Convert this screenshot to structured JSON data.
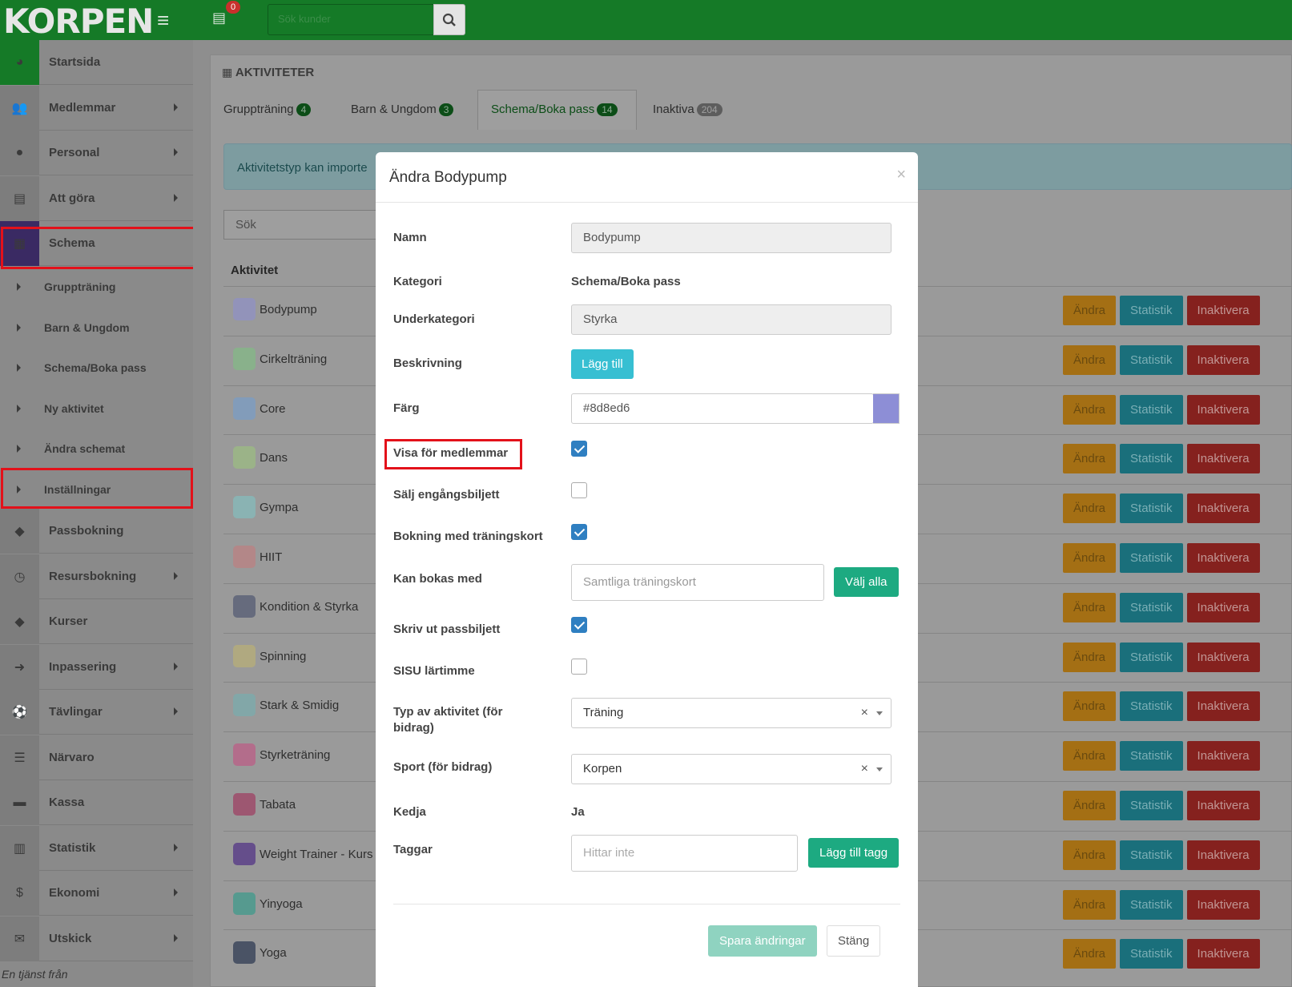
{
  "topbar": {
    "logo": "KORPEN",
    "notif_count": "0",
    "search_placeholder": "Sök kunder"
  },
  "sidebar": {
    "items": [
      {
        "label": "Startsida",
        "icon": "dashboard-icon",
        "arrow": false
      },
      {
        "label": "Medlemmar",
        "icon": "users-icon",
        "arrow": true
      },
      {
        "label": "Personal",
        "icon": "user-icon",
        "arrow": true
      },
      {
        "label": "Att göra",
        "icon": "list-icon",
        "arrow": true
      },
      {
        "label": "Schema",
        "icon": "calendar-icon",
        "arrow": false
      }
    ],
    "sub_items": [
      "Gruppträning",
      "Barn & Ungdom",
      "Schema/Boka pass",
      "Ny aktivitet",
      "Ändra schemat",
      "Inställningar"
    ],
    "items_after": [
      {
        "label": "Passbokning",
        "icon": "ticket-icon",
        "arrow": false
      },
      {
        "label": "Resursbokning",
        "icon": "clock-icon",
        "arrow": true
      },
      {
        "label": "Kurser",
        "icon": "ticket-icon",
        "arrow": false
      },
      {
        "label": "Inpassering",
        "icon": "sign-in-icon",
        "arrow": true
      },
      {
        "label": "Tävlingar",
        "icon": "soccer-icon",
        "arrow": true
      },
      {
        "label": "Närvaro",
        "icon": "list-lines-icon",
        "arrow": false
      },
      {
        "label": "Kassa",
        "icon": "register-icon",
        "arrow": false
      },
      {
        "label": "Statistik",
        "icon": "bar-chart-icon",
        "arrow": true
      },
      {
        "label": "Ekonomi",
        "icon": "dollar-icon",
        "arrow": true
      },
      {
        "label": "Utskick",
        "icon": "envelope-icon",
        "arrow": true
      }
    ],
    "footer": "En tjänst från"
  },
  "main": {
    "title": "AKTIVITETER",
    "tabs": [
      {
        "label": "Gruppträning",
        "count": "4"
      },
      {
        "label": "Barn & Ungdom",
        "count": "3"
      },
      {
        "label": "Schema/Boka pass",
        "count": "14"
      },
      {
        "label": "Inaktiva",
        "count": "204"
      }
    ],
    "alert": "Aktivitetstyp kan importe",
    "search_placeholder": "Sök",
    "column_header": "Aktivitet",
    "buttons": {
      "edit": "Ändra",
      "stats": "Statistik",
      "deactivate": "Inaktivera"
    },
    "rows": [
      {
        "name": "Bodypump",
        "color": "#8d8ed6"
      },
      {
        "name": "Cirkelträning",
        "color": "#7bc47f"
      },
      {
        "name": "Core",
        "color": "#6f9fd6"
      },
      {
        "name": "Dans",
        "color": "#9cc87a"
      },
      {
        "name": "Gympa",
        "color": "#7ec9c9"
      },
      {
        "name": "HIIT",
        "color": "#c9787a"
      },
      {
        "name": "Kondition & Styrka",
        "color": "#3d4566"
      },
      {
        "name": "Spinning",
        "color": "#c2b66c"
      },
      {
        "name": "Stark & Smidig",
        "color": "#6fb2b5"
      },
      {
        "name": "Styrketräning",
        "color": "#c9487f"
      },
      {
        "name": "Tabata",
        "color": "#a02050"
      },
      {
        "name": "Weight Trainer - Kurs",
        "color": "#3b1080"
      },
      {
        "name": "Yinyoga",
        "color": "#1f9a86"
      },
      {
        "name": "Yoga",
        "color": "#0a1a3a"
      }
    ]
  },
  "modal": {
    "title": "Ändra Bodypump",
    "close": "×",
    "fields": {
      "name_label": "Namn",
      "name_value": "Bodypump",
      "category_label": "Kategori",
      "category_value": "Schema/Boka pass",
      "subcategory_label": "Underkategori",
      "subcategory_value": "Styrka",
      "description_label": "Beskrivning",
      "description_button": "Lägg till",
      "color_label": "Färg",
      "color_value": "#8d8ed6",
      "show_members_label": "Visa för medlemmar",
      "show_members_checked": true,
      "sell_single_label": "Sälj engångsbiljett",
      "sell_single_checked": false,
      "booking_card_label": "Bokning med träningskort",
      "booking_card_checked": true,
      "bookable_with_label": "Kan bokas med",
      "bookable_with_placeholder": "Samtliga träningskort",
      "select_all_button": "Välj alla",
      "print_ticket_label": "Skriv ut passbiljett",
      "print_ticket_checked": true,
      "sisu_label": "SISU lärtimme",
      "sisu_checked": false,
      "activity_type_label_1": "Typ av aktivitet (för",
      "activity_type_label_2": "bidrag)",
      "activity_type_value": "Träning",
      "sport_label": "Sport (för bidrag)",
      "sport_value": "Korpen",
      "chain_label": "Kedja",
      "chain_value": "Ja",
      "tags_label": "Taggar",
      "tags_placeholder": "Hittar inte",
      "add_tag_button": "Lägg till tagg"
    },
    "save_button": "Spara ändringar",
    "close_button": "Stäng"
  },
  "colors": {
    "topbar": "#157a27",
    "highlight": "#e3111a",
    "primary_check": "#2f7fc1",
    "success": "#1daa81",
    "info": "#37bfd2"
  }
}
